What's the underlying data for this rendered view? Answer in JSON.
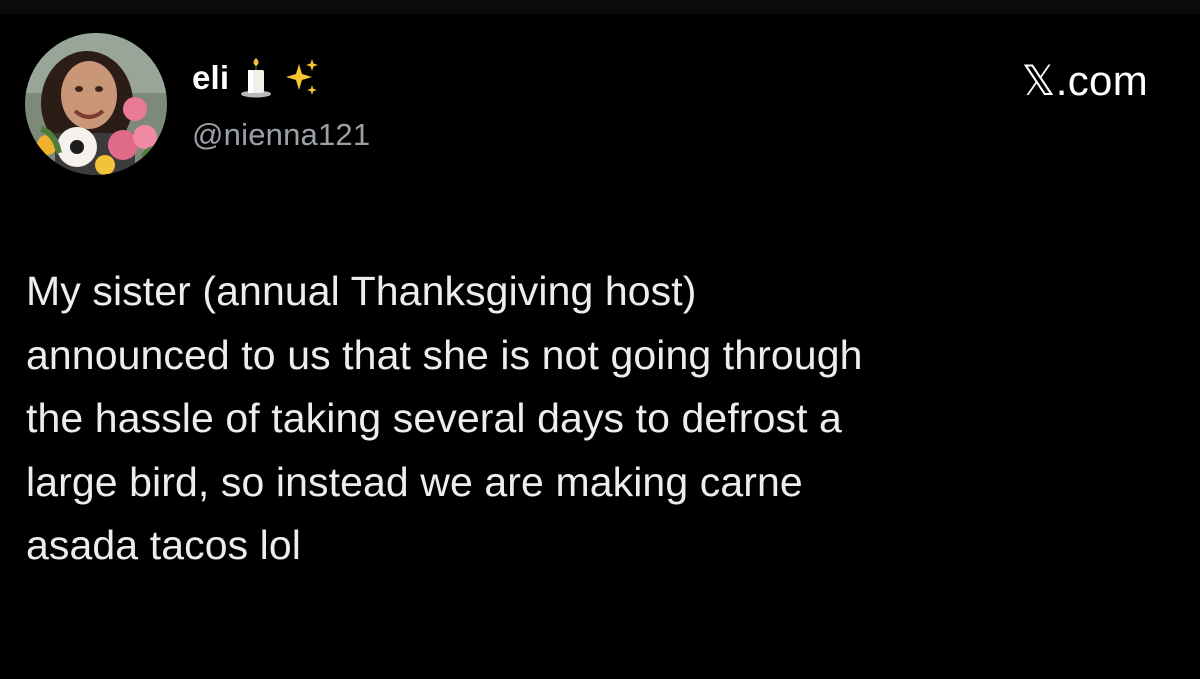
{
  "author": {
    "display_name": "eli",
    "handle": "@nienna121",
    "name_emojis": [
      "candle-icon",
      "sparkles-icon"
    ]
  },
  "brand": {
    "label": "𝕏.com"
  },
  "tweet": {
    "lines": [
      "My sister (annual Thanksgiving host)",
      "announced to us that she is not going through",
      "the hassle of taking several days to defrost a",
      "large bird, so instead we are making carne",
      "asada tacos lol"
    ]
  },
  "colors": {
    "background": "#000000",
    "text_primary": "#ffffff",
    "text_secondary": "#9aa0a6"
  }
}
